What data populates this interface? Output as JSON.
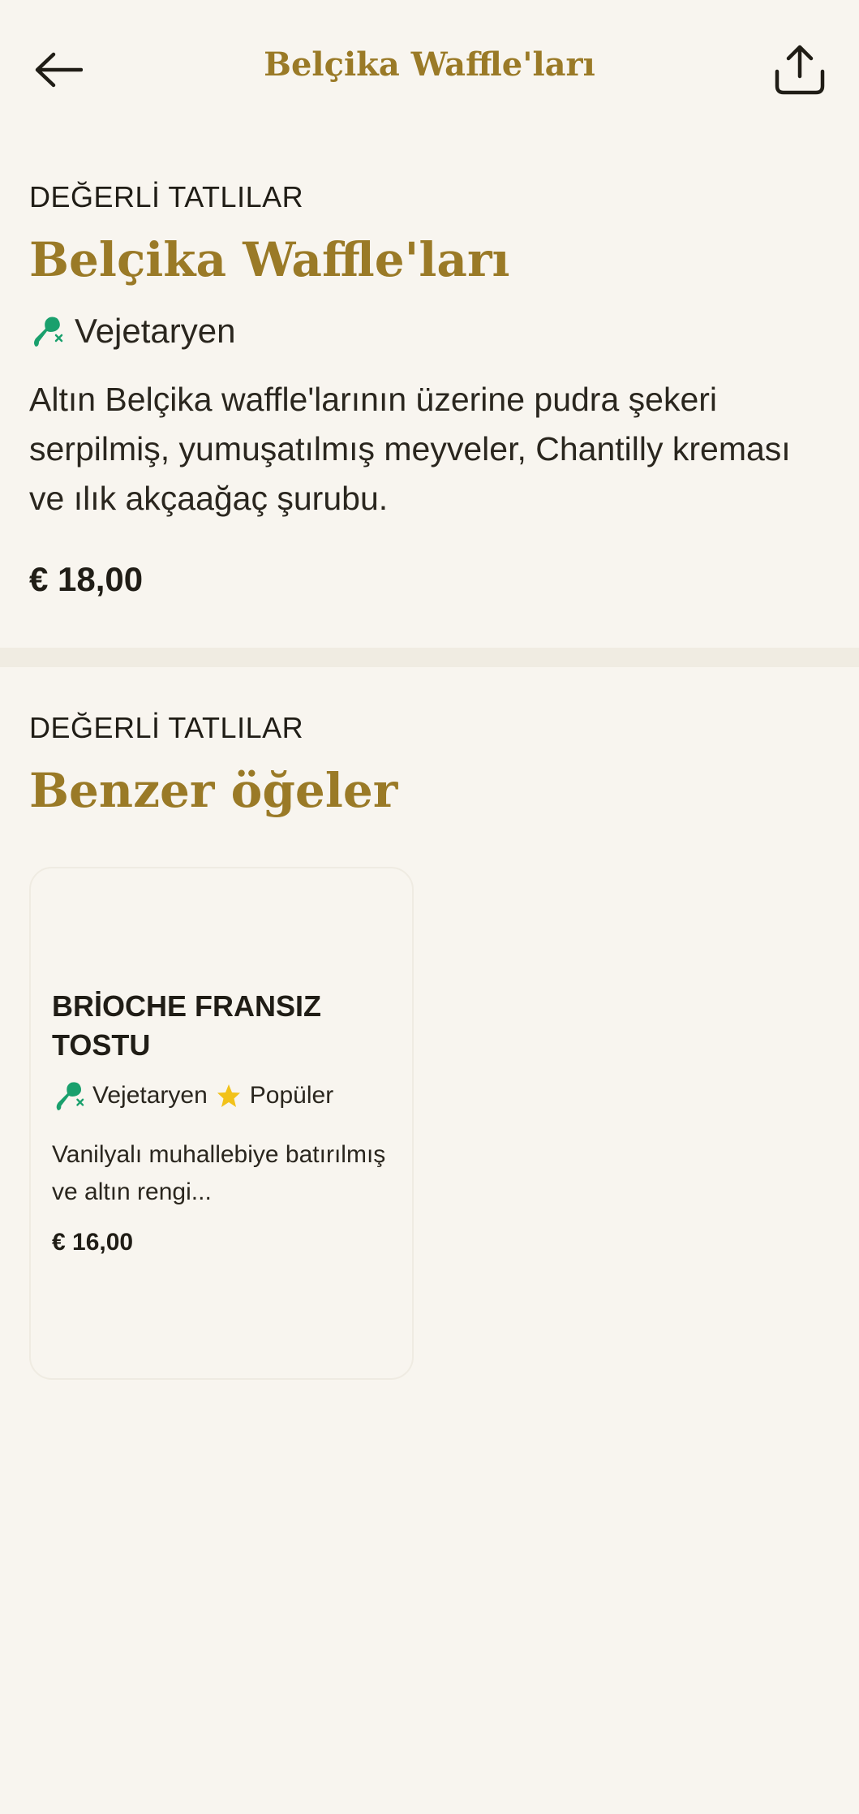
{
  "header": {
    "title": "Belçika Waffle'ları",
    "back_icon": "arrow-left-icon",
    "share_icon": "share-icon"
  },
  "item": {
    "category": "DEĞERLİ TATLILAR",
    "name": "Belçika Waffle'ları",
    "diet_label": "Vejetaryen",
    "diet_icon": "vegetarian-icon",
    "description": "Altın Belçika waffle'larının üzerine pudra şekeri serpilmiş, yumuşatılmış meyveler, Chantilly kreması ve ılık akçaağaç şurubu.",
    "price": "€ 18,00"
  },
  "similar": {
    "category": "DEĞERLİ TATLILAR",
    "title": "Benzer öğeler",
    "items": [
      {
        "name": "BRİOCHE FRANSIZ TOSTU",
        "diet_label": "Vejetaryen",
        "popular_label": "Popüler",
        "popular_icon": "star-icon",
        "description": "Vanilyalı muhallebiye batırılmış ve altın rengi...",
        "price": "€ 16,00"
      }
    ]
  },
  "colors": {
    "background": "#f8f5ef",
    "accent_gold": "#9a7a27",
    "vegetarian_green": "#1aa06d",
    "star_yellow": "#f2c21a",
    "text_dark": "#201d16"
  }
}
